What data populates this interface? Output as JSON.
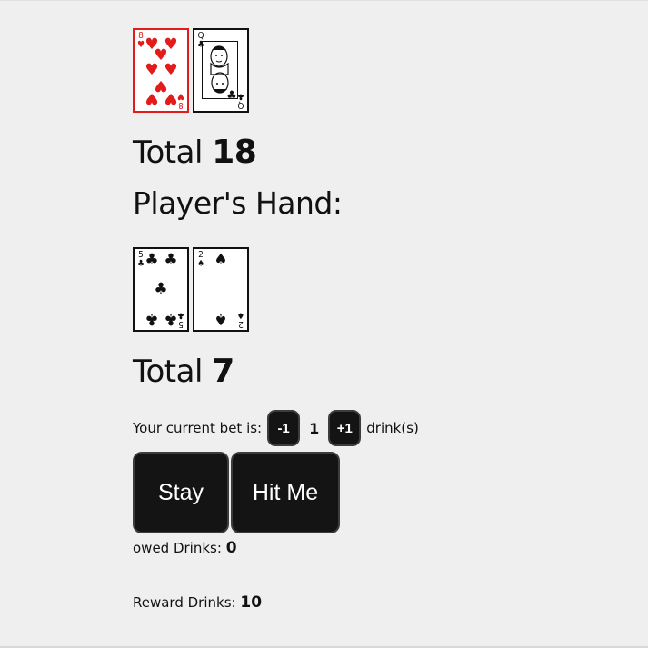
{
  "dealer": {
    "cards": [
      {
        "rank": "8",
        "suit": "♥",
        "color": "red",
        "name": "eight-of-hearts"
      },
      {
        "rank": "Q",
        "suit": "♣",
        "color": "black",
        "name": "queen-of-clubs"
      }
    ],
    "total_label": "Total",
    "total_value": "18"
  },
  "player": {
    "heading": "Player's Hand:",
    "cards": [
      {
        "rank": "5",
        "suit": "♣",
        "color": "black",
        "name": "five-of-clubs"
      },
      {
        "rank": "2",
        "suit": "♠",
        "color": "black",
        "name": "two-of-spades"
      }
    ],
    "total_label": "Total",
    "total_value": "7"
  },
  "bet": {
    "prefix": "Your current bet is:",
    "decrease_label": "-1",
    "value": "1",
    "increase_label": "+1",
    "suffix": "drink(s)"
  },
  "actions": {
    "stay_label": "Stay",
    "hit_label": "Hit Me"
  },
  "stats": {
    "owed_label": "owed Drinks:",
    "owed_value": "0",
    "reward_label": "Reward Drinks:",
    "reward_value": "10"
  },
  "colors": {
    "background": "#efefef",
    "button_bg": "#141414",
    "button_text": "#ffffff",
    "red_suit": "#e21b1b"
  }
}
